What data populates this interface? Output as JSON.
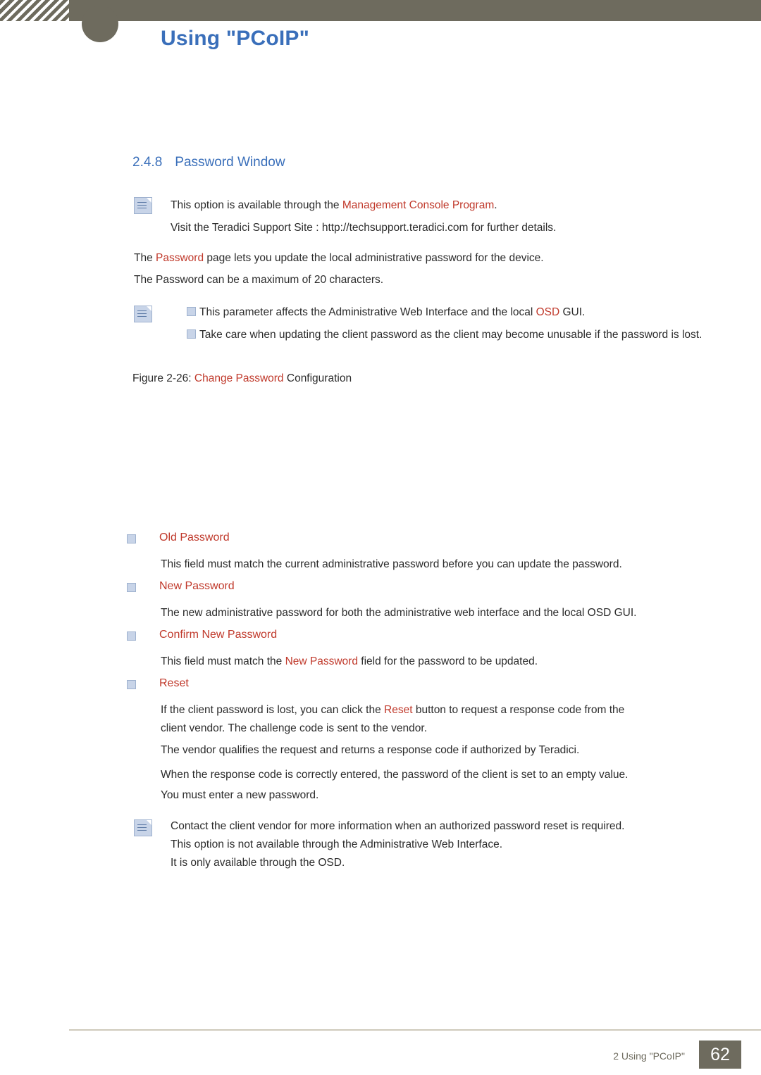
{
  "header": {
    "title": "Using \"PCoIP\""
  },
  "section": {
    "number": "2.4.8",
    "title": "Password Window"
  },
  "note1": {
    "line1_pre": "This option is available through the ",
    "line1_link": "Management Console Program",
    "line1_post": ".",
    "line2": "Visit the Teradici Support Site : http://techsupport.teradici.com for further details."
  },
  "intro": {
    "line1_pre": "The ",
    "line1_link": "Password",
    "line1_post": " page lets you update the local administrative password for the device.",
    "line2": "The  Password can be a maximum of 20 characters."
  },
  "note2": {
    "item1_pre": "This parameter affects the Administrative Web Interface and the local ",
    "item1_link": "OSD",
    "item1_post": " GUI.",
    "item2": "Take care when updating the client password as the client may become unusable if the password is lost."
  },
  "figure": {
    "label": "Figure 2-26:",
    "link": "Change Password",
    "suffix": "Configuration"
  },
  "fields": [
    {
      "title": "Old Password",
      "body": "This field must match the current administrative password before you can update the password."
    },
    {
      "title": "New Password",
      "body": "The new administrative password for both the administrative web interface and the local OSD GUI."
    },
    {
      "title": "Confirm New Password",
      "body_pre": "This field must match the ",
      "body_link": "New Password",
      "body_post": " field for the password to be updated."
    },
    {
      "title": "Reset",
      "body_pre": "If the client password is lost, you can click the ",
      "body_link": "Reset",
      "body_post": " button to request a response code from the",
      "body_line2": "client vendor. The challenge code is sent to the vendor.",
      "body_line3_pre": "The vendor qualifies the request and returns a response code if authorized by ",
      "body_line3_link": "Teradici",
      "body_line3_post": ".",
      "body_line4": "When the response code is correctly entered, the password of the client is set to an empty value.",
      "body_line5": "You must enter a new password."
    }
  ],
  "note3": {
    "line1": "Contact the client vendor for more information when an authorized password reset is required.",
    "line2": "This option is not available through the Administrative Web Interface.",
    "line3": "It is only available through the OSD."
  },
  "footer": {
    "text": "2 Using \"PCoIP\"",
    "page": "62"
  },
  "colors": {
    "header_band": "#6e6b5e",
    "title_blue": "#3a6fba",
    "link_red": "#c0392b",
    "body": "#2b2b2b"
  }
}
